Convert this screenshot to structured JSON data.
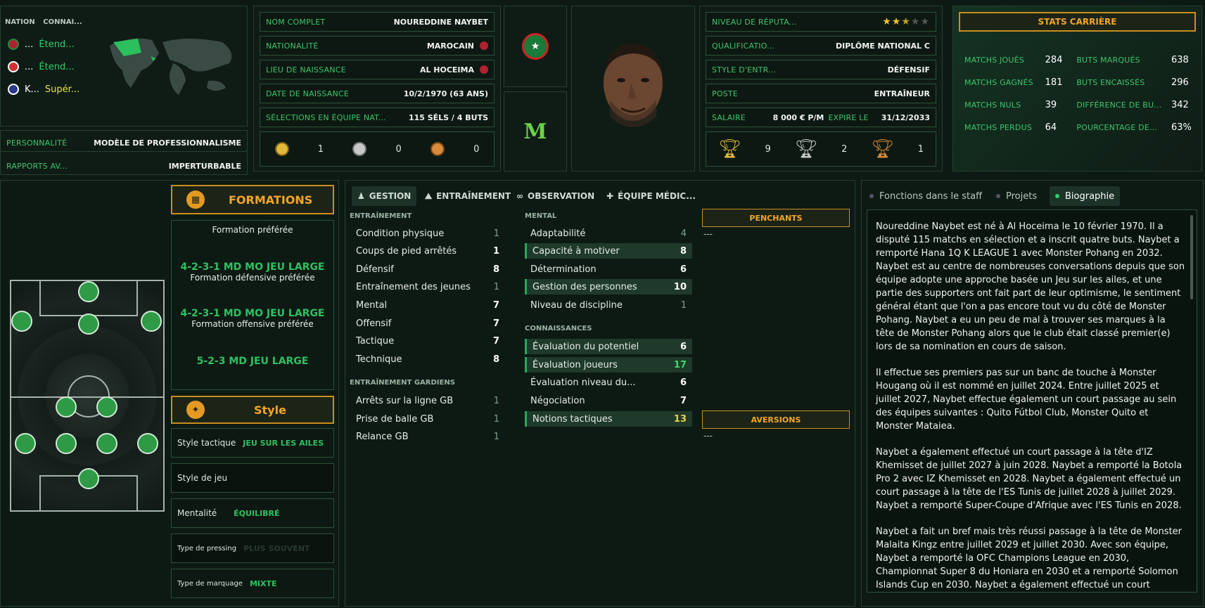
{
  "nations": {
    "headers": [
      "NATION",
      "CONNAI..."
    ],
    "rows": [
      {
        "name": "...",
        "level": "Étend..."
      },
      {
        "name": "...",
        "level": "Étend..."
      },
      {
        "name": "K...",
        "level": "Supér..."
      }
    ]
  },
  "personality": {
    "label": "PERSONNALITÉ",
    "value": "MODÈLE DE PROFESSIONNALISME"
  },
  "media": {
    "label": "RAPPORTS AV...",
    "value": "IMPERTURBABLE"
  },
  "profile": {
    "full_name": {
      "label": "NOM COMPLET",
      "value": "NOUREDDINE NAYBET"
    },
    "nationality": {
      "label": "NATIONALITÉ",
      "value": "MAROCAIN"
    },
    "birthplace": {
      "label": "LIEU DE NAISSANCE",
      "value": "AL HOCEIMA"
    },
    "birthdate": {
      "label": "DATE DE NAISSANCE",
      "value": "10/2/1970 (63 ANS)"
    },
    "caps": {
      "label": "SÉLECTIONS EN ÉQUIPE NAT...",
      "value": "115 SÉLS / 4 BUTS"
    },
    "medals": {
      "gold": "1",
      "silver": "0",
      "bronze": "0"
    }
  },
  "info": {
    "reputation": {
      "label": "NIVEAU DE RÉPUTA...",
      "stars": 2.5
    },
    "qualification": {
      "label": "QUALIFICATIO...",
      "value": "DIPLÔME NATIONAL C"
    },
    "style": {
      "label": "STYLE D'ENTR...",
      "value": "DÉFENSIF"
    },
    "position": {
      "label": "POSTE",
      "value": "ENTRAÎNEUR"
    },
    "salary": {
      "label": "SALAIRE",
      "value": "8 000 € P/M",
      "expires_label": "EXPIRE LE",
      "expires": "31/12/2033"
    },
    "trophies": {
      "gold": "9",
      "silver": "2",
      "bronze": "1"
    }
  },
  "career": {
    "title": "STATS CARRIÈRE",
    "left": [
      {
        "label": "MATCHS JOUÉS",
        "value": "284"
      },
      {
        "label": "MATCHS GAGNÉS",
        "value": "181"
      },
      {
        "label": "MATCHS NULS",
        "value": "39"
      },
      {
        "label": "MATCHS PERDUS",
        "value": "64"
      }
    ],
    "right": [
      {
        "label": "BUTS MARQUÉS",
        "value": "638"
      },
      {
        "label": "BUTS ENCAISSÉS",
        "value": "296"
      },
      {
        "label": "DIFFÉRENCE DE BU...",
        "value": "342"
      },
      {
        "label": "POURCENTAGE DE...",
        "value": "63%"
      }
    ]
  },
  "formations": {
    "title": "FORMATIONS",
    "preferred_label": "Formation préférée",
    "defensive": "4-2-3-1 MD MO JEU LARGE",
    "defensive_label": "Formation défensive préférée",
    "offensive": "4-2-3-1 MD MO JEU LARGE",
    "offensive_label": "Formation offensive préférée",
    "third": "5-2-3 MD JEU LARGE"
  },
  "style": {
    "title": "Style",
    "rows": [
      {
        "label": "Style tactique",
        "value": "JEU SUR LES AILES"
      },
      {
        "label": "Style de jeu",
        "value": ""
      },
      {
        "label": "Mentalité",
        "value": "ÉQUILIBRÉ"
      },
      {
        "label": "Type de pressing",
        "value": "PLUS SOUVENT"
      },
      {
        "label": "Type de marquage",
        "value": "MIXTE"
      }
    ]
  },
  "tabs": [
    "GESTION",
    "ENTRAÎNEMENT",
    "OBSERVATION",
    "ÉQUIPE MÉDIC..."
  ],
  "attributes": {
    "training_title": "ENTRAÎNEMENT",
    "training": [
      {
        "name": "Condition physique",
        "value": "1"
      },
      {
        "name": "Coups de pied arrêtés",
        "value": "1"
      },
      {
        "name": "Défensif",
        "value": "8"
      },
      {
        "name": "Entraînement des jeunes",
        "value": "1"
      },
      {
        "name": "Mental",
        "value": "7"
      },
      {
        "name": "Offensif",
        "value": "7"
      },
      {
        "name": "Tactique",
        "value": "7"
      },
      {
        "name": "Technique",
        "value": "8"
      }
    ],
    "gk_title": "ENTRAÎNEMENT GARDIENS",
    "gk": [
      {
        "name": "Arrêts sur la ligne GB",
        "value": "1"
      },
      {
        "name": "Prise de balle GB",
        "value": "1"
      },
      {
        "name": "Relance GB",
        "value": "1"
      }
    ],
    "mental_title": "MENTAL",
    "mental": [
      {
        "name": "Adaptabilité",
        "value": "4"
      },
      {
        "name": "Capacité à motiver",
        "value": "8"
      },
      {
        "name": "Détermination",
        "value": "6"
      },
      {
        "name": "Gestion des personnes",
        "value": "10"
      },
      {
        "name": "Niveau de discipline",
        "value": "1"
      }
    ],
    "knowledge_title": "CONNAISSANCES",
    "knowledge": [
      {
        "name": "Évaluation du potentiel",
        "value": "6"
      },
      {
        "name": "Évaluation joueurs",
        "value": "17"
      },
      {
        "name": "Évaluation niveau du...",
        "value": "6"
      },
      {
        "name": "Négociation",
        "value": "7"
      },
      {
        "name": "Notions tactiques",
        "value": "13"
      }
    ],
    "likes_title": "PENCHANTS",
    "likes_value": "---",
    "dislikes_title": "AVERSIONS",
    "dislikes_value": "---"
  },
  "bio_tabs": [
    "Fonctions dans le staff",
    "Projets",
    "Biographie"
  ],
  "bio": [
    "Noureddine Naybet est né à Al Hoceima le 10 février 1970. Il a disputé 115 matchs en sélection et a inscrit quatre buts. Naybet a remporté Hana 1Q K LEAGUE 1 avec Monster Pohang en 2032. Naybet est au centre de nombreuses conversations depuis que son équipe adopte une approche basée un Jeu sur les ailes, et une partie des supporters ont fait part de leur optimisme, le sentiment général étant que l'on a pas encore tout vu du côté de Monster Pohang. Naybet a eu un peu de mal à trouver ses marques à la tête de Monster Pohang alors que le club était classé premier(e) lors de sa nomination en cours de saison.",
    "Il effectue ses premiers pas sur un banc de touche à Monster Hougang où il est nommé en juillet 2024. Entre juillet 2025 et juillet 2027, Naybet effectue également un court passage au sein des équipes suivantes : Quito Fútbol Club, Monster Quito et Monster Mataiea.",
    "Naybet a également effectué un court passage à la tête d'IZ Khemisset de juillet 2027 à juin 2028. Naybet a remporté la Botola Pro 2 avec IZ Khemisset en 2028. Naybet a également effectué un court passage à la tête de l'ES Tunis de juillet 2028 à juillet 2029. Naybet a remporté Super-Coupe d'Afrique avec l'ES Tunis en 2028.",
    "Naybet a fait un bref mais très réussi passage à la tête de Monster Malaita Kingz entre juillet 2029 et juillet 2030. Avec son équipe, Naybet a remporté la OFC Champions League en 2030, Championnat Super 8 du Honiara en 2030 et a remporté Solomon Islands Cup en 2030. Naybet a également effectué un court passage"
  ]
}
